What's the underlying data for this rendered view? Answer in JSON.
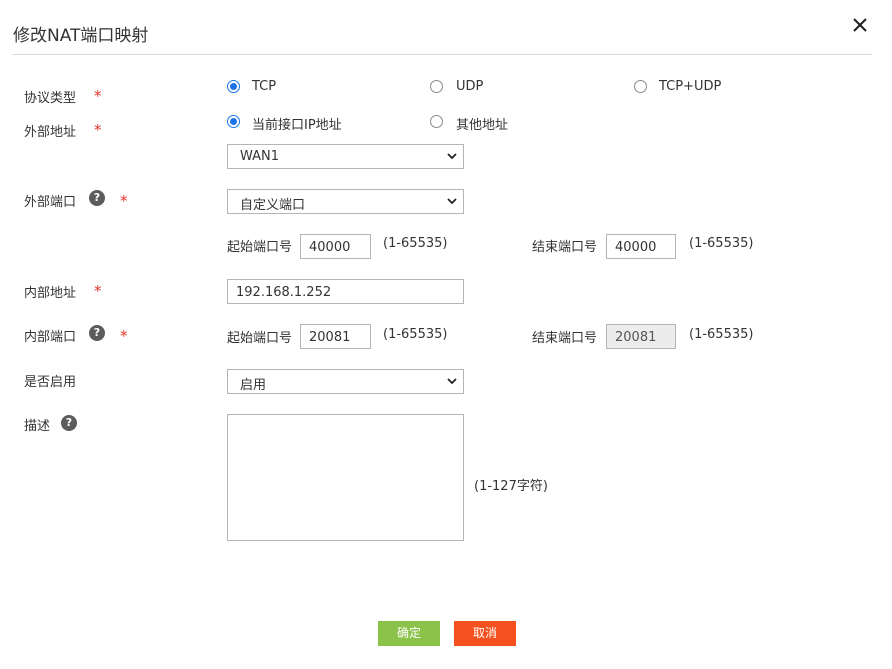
{
  "dialog": {
    "title": "修改NAT端口映射"
  },
  "form": {
    "required_mark": "*",
    "protocol": {
      "label": "协议类型",
      "options": [
        "TCP",
        "UDP",
        "TCP+UDP"
      ],
      "selected": "TCP"
    },
    "external_address": {
      "label": "外部地址",
      "options": [
        "当前接口IP地址",
        "其他地址"
      ],
      "selected": "当前接口IP地址",
      "interface_value": "WAN1"
    },
    "external_port": {
      "label": "外部端口",
      "mode_value": "自定义端口",
      "start_label": "起始端口号",
      "start_value": "40000",
      "start_range": "(1-65535)",
      "end_label": "结束端口号",
      "end_value": "40000",
      "end_range": "(1-65535)"
    },
    "internal_address": {
      "label": "内部地址",
      "value": "192.168.1.252"
    },
    "internal_port": {
      "label": "内部端口",
      "start_label": "起始端口号",
      "start_value": "20081",
      "start_range": "(1-65535)",
      "end_label": "结束端口号",
      "end_value": "20081",
      "end_range": "(1-65535)"
    },
    "enable": {
      "label": "是否启用",
      "value": "启用"
    },
    "description": {
      "label": "描述",
      "value": "",
      "limit": "(1-127字符)"
    }
  },
  "buttons": {
    "ok": "确定",
    "cancel": "取消"
  },
  "colors": {
    "accent": "#1a73e8",
    "required": "#e5332a",
    "ok_button": "#8bc34a",
    "cancel_button": "#f4511e"
  }
}
